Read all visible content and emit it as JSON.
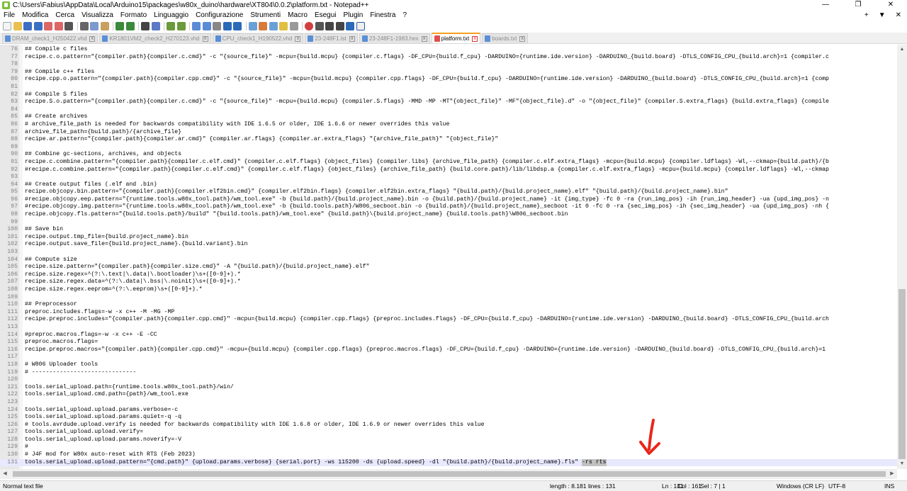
{
  "window": {
    "title": "C:\\Users\\Fabius\\AppData\\Local\\Arduino15\\packages\\w80x_duino\\hardware\\XT804\\0.0.2\\platform.txt - Notepad++",
    "minimize": "—",
    "maximize": "❐",
    "close": "✕"
  },
  "menu": {
    "items": [
      "File",
      "Modifica",
      "Cerca",
      "Visualizza",
      "Formato",
      "Linguaggio",
      "Configurazione",
      "Strumenti",
      "Macro",
      "Esegui",
      "Plugin",
      "Finestra",
      "?"
    ],
    "right_controls": [
      "+",
      "▼",
      "✕"
    ]
  },
  "tabs": [
    {
      "label": "DRAM_check1_H250422.vhd",
      "active": false
    },
    {
      "label": "KR1801VM2_check2_H270123.vhd",
      "active": false
    },
    {
      "label": "CPU_check1_H190522.vhd",
      "active": false
    },
    {
      "label": "23-248F1.lst",
      "active": false
    },
    {
      "label": "23-248F1-1983.hex",
      "active": false
    },
    {
      "label": "platform.txt",
      "active": true
    },
    {
      "label": "boards.txt",
      "active": false
    }
  ],
  "editor": {
    "lines": [
      {
        "n": "76",
        "t": "## Compile c files"
      },
      {
        "n": "77",
        "t": "recipe.c.o.pattern=\"{compiler.path}{compiler.c.cmd}\" -c \"{source_file}\" -mcpu={build.mcpu} {compiler.c.flags} -DF_CPU={build.f_cpu} -DARDUINO={runtime.ide.version} -DARDUINO_{build.board} -DTLS_CONFIG_CPU_{build.arch}=1 {compiler.c"
      },
      {
        "n": "78",
        "t": ""
      },
      {
        "n": "79",
        "t": "## Compile c++ files"
      },
      {
        "n": "80",
        "t": "recipe.cpp.o.pattern=\"{compiler.path}{compiler.cpp.cmd}\" -c \"{source_file}\" -mcpu={build.mcpu} {compiler.cpp.flags} -DF_CPU={build.f_cpu} -DARDUINO={runtime.ide.version} -DARDUINO_{build.board} -DTLS_CONFIG_CPU_{build.arch}=1 {comp"
      },
      {
        "n": "81",
        "t": ""
      },
      {
        "n": "82",
        "t": "## Compile S files"
      },
      {
        "n": "83",
        "t": "recipe.S.o.pattern=\"{compiler.path}{compiler.c.cmd}\" -c \"{source_file}\" -mcpu={build.mcpu} {compiler.S.flags} -MMD -MP -MT\"{object_file}\" -MF\"{object_file}.d\" -o \"{object_file}\" {compiler.S.extra_flags} {build.extra_flags} {compile"
      },
      {
        "n": "84",
        "t": ""
      },
      {
        "n": "85",
        "t": "## Create archives"
      },
      {
        "n": "86",
        "t": "# archive_file_path is needed for backwards compatibility with IDE 1.6.5 or older, IDE 1.6.6 or newer overrides this value"
      },
      {
        "n": "87",
        "t": "archive_file_path={build.path}/{archive_file}"
      },
      {
        "n": "88",
        "t": "recipe.ar.pattern=\"{compiler.path}{compiler.ar.cmd}\" {compiler.ar.flags} {compiler.ar.extra_flags} \"{archive_file_path}\" \"{object_file}\""
      },
      {
        "n": "89",
        "t": ""
      },
      {
        "n": "90",
        "t": "## Combine gc-sections, archives, and objects"
      },
      {
        "n": "91",
        "t": "recipe.c.combine.pattern=\"{compiler.path}{compiler.c.elf.cmd}\" {compiler.c.elf.flags} {object_files} {compiler.libs} {archive_file_path} {compiler.c.elf.extra_flags} -mcpu={build.mcpu} {compiler.ldflags} -Wl,--ckmap={build.path}/{b"
      },
      {
        "n": "92",
        "t": "#recipe.c.combine.pattern=\"{compiler.path}{compiler.c.elf.cmd}\" {compiler.c.elf.flags} {object_files} {archive_file_path} {build.core.path}/lib/libdsp.a {compiler.c.elf.extra_flags} -mcpu={build.mcpu} {compiler.ldflags} -Wl,--ckmap"
      },
      {
        "n": "93",
        "t": ""
      },
      {
        "n": "94",
        "t": "## Create output files (.elf and .bin)"
      },
      {
        "n": "95",
        "t": "recipe.objcopy.bin.pattern=\"{compiler.path}{compiler.elf2bin.cmd}\" {compiler.elf2bin.flags} {compiler.elf2bin.extra_flags} \"{build.path}/{build.project_name}.elf\" \"{build.path}/{build.project_name}.bin\""
      },
      {
        "n": "96",
        "t": "#recipe.objcopy.eep.pattern=\"{runtime.tools.w80x_tool.path}/wm_tool.exe\" -b {build.path}/{build.project_name}.bin -o {build.path}/{build.project_name} -it {img_type} -fc 0 -ra {run_img_pos} -ih {run_img_header} -ua {upd_img_pos} -n"
      },
      {
        "n": "97",
        "t": "#recipe.objcopy.img.pattern=\"{runtime.tools.w80x_tool.path}/wm_tool.exe\" -b {build.tools.path}/W806_secboot.bin -o {build.path}/{build.project_name}_secboot -it 0 -fc 0 -ra {sec_img_pos} -ih {sec_img_header} -ua {upd_img_pos} -nh {"
      },
      {
        "n": "98",
        "t": "recipe.objcopy.fls.pattern=\"{build.tools.path}/build\" \"{build.tools.path}/wm_tool.exe\" {build.path}\\{build.project_name} {build.tools.path}\\W806_secboot.bin"
      },
      {
        "n": "99",
        "t": ""
      },
      {
        "n": "100",
        "t": "## Save bin"
      },
      {
        "n": "101",
        "t": "recipe.output.tmp_file={build.project_name}.bin"
      },
      {
        "n": "102",
        "t": "recipe.output.save_file={build.project_name}.{build.variant}.bin"
      },
      {
        "n": "103",
        "t": ""
      },
      {
        "n": "104",
        "t": "## Compute size"
      },
      {
        "n": "105",
        "t": "recipe.size.pattern=\"{compiler.path}{compiler.size.cmd}\" -A \"{build.path}/{build.project_name}.elf\""
      },
      {
        "n": "106",
        "t": "recipe.size.regex=^(?:\\.text|\\.data|\\.bootloader)\\s+([0-9]+).*"
      },
      {
        "n": "107",
        "t": "recipe.size.regex.data=^(?:\\.data|\\.bss|\\.noinit)\\s+([0-9]+).*"
      },
      {
        "n": "108",
        "t": "recipe.size.regex.eeprom=^(?:\\.eeprom)\\s+([0-9]+).*"
      },
      {
        "n": "109",
        "t": ""
      },
      {
        "n": "110",
        "t": "## Preprocessor"
      },
      {
        "n": "111",
        "t": "preproc.includes.flags=-w -x c++ -M -MG -MP"
      },
      {
        "n": "112",
        "t": "recipe.preproc.includes=\"{compiler.path}{compiler.cpp.cmd}\" -mcpu={build.mcpu} {compiler.cpp.flags} {preproc.includes.flags} -DF_CPU={build.f_cpu} -DARDUINO={runtime.ide.version} -DARDUINO_{build.board} -DTLS_CONFIG_CPU_{build.arch"
      },
      {
        "n": "113",
        "t": ""
      },
      {
        "n": "114",
        "t": "#preproc.macros.flags=-w -x c++ -E -CC"
      },
      {
        "n": "115",
        "t": "preproc.macros.flags="
      },
      {
        "n": "116",
        "t": "recipe.preproc.macros=\"{compiler.path}{compiler.cpp.cmd}\" -mcpu={build.mcpu} {compiler.cpp.flags} {preproc.macros.flags} -DF_CPU={build.f_cpu} -DARDUINO={runtime.ide.version} -DARDUINO_{build.board} -DTLS_CONFIG_CPU_{build.arch}=1"
      },
      {
        "n": "117",
        "t": ""
      },
      {
        "n": "118",
        "t": "# W806 Uploader tools"
      },
      {
        "n": "119",
        "t": "# ------------------------------"
      },
      {
        "n": "120",
        "t": ""
      },
      {
        "n": "121",
        "t": "tools.serial_upload.path={runtime.tools.w80x_tool.path}/win/"
      },
      {
        "n": "122",
        "t": "tools.serial_upload.cmd.path={path}/wm_tool.exe"
      },
      {
        "n": "123",
        "t": ""
      },
      {
        "n": "124",
        "t": "tools.serial_upload.upload.params.verbose=-c"
      },
      {
        "n": "125",
        "t": "tools.serial_upload.upload.params.quiet=-q -q"
      },
      {
        "n": "126",
        "t": "# tools.avrdude.upload.verify is needed for backwards compatibility with IDE 1.6.8 or older, IDE 1.6.9 or newer overrides this value"
      },
      {
        "n": "127",
        "t": "tools.serial_upload.upload.verify="
      },
      {
        "n": "128",
        "t": "tools.serial_upload.upload.params.noverify=-V"
      },
      {
        "n": "129",
        "t": "#"
      },
      {
        "n": "130",
        "t": "# J4F mod for W80x auto-reset with RTS (Feb 2023)"
      },
      {
        "n": "131",
        "t": "tools.serial_upload.upload.pattern=\"{cmd.path}\" {upload.params.verbose} {serial.port} -ws 115200 -ds {upload.speed} -dl \"{build.path}/{build.project_name}.fls\" ",
        "sel": "-rs rts",
        "current": true
      }
    ]
  },
  "status": {
    "file_type": "Normal text file",
    "length": "length : 8.181",
    "lines": "lines : 131",
    "ln": "Ln : 131",
    "col": "Col : 161",
    "sel": "Sel : 7 | 1",
    "eol": "Windows (CR LF)",
    "encoding": "UTF-8",
    "mode": "INS"
  },
  "icons": {
    "annotation_arrow": "red-arrow-icon",
    "app": "notepadpp-icon"
  },
  "colors": {
    "annotation": "#e8261b",
    "active_tab_accent": "#f7a020",
    "current_line": "#e8e8ff",
    "selection": "#c0c0c0"
  }
}
